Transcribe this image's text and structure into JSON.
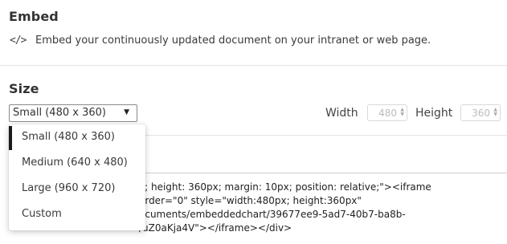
{
  "embed": {
    "title": "Embed",
    "description": "Embed your continuously updated document on your intranet or web page.",
    "icon": "code-icon",
    "icon_glyph": "</>"
  },
  "size": {
    "title": "Size",
    "selected": "Small (480 x 360)",
    "options": [
      "Small (480 x 360)",
      "Medium (640 x 480)",
      "Large (960 x 720)",
      "Custom"
    ],
    "width_label": "Width",
    "width_value": "480",
    "height_label": "Height",
    "height_value": "360"
  },
  "code": {
    "lines": [
      "x; height: 360px; margin: 10px; position: relative;\"><iframe",
      "order=\"0\" style=\"width:480px; height:360px\"",
      "ocuments/embeddedchart/39677ee9-5ad7-40b7-ba8b-",
      "/uZ0aKja4V\"></iframe></div>"
    ]
  }
}
